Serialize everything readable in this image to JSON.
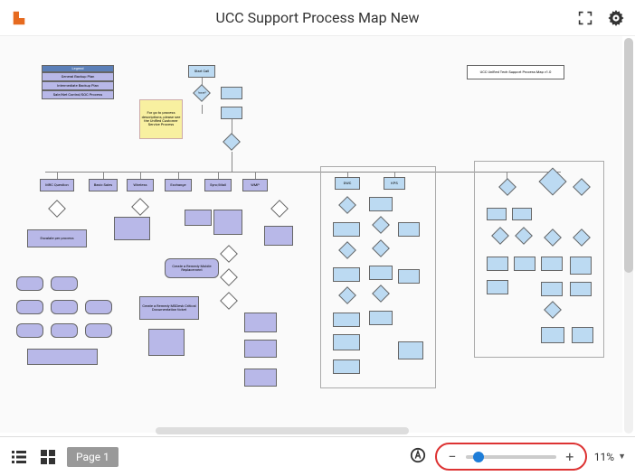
{
  "header": {
    "title": "UCC Support Process Map New"
  },
  "footer": {
    "page_tab": "Page 1",
    "zoom_value": "11%"
  },
  "icons": {
    "logo": "logo-l",
    "fullscreen": "fullscreen",
    "settings": "gear",
    "list": "list",
    "grid": "grid",
    "autozoom": "autozoom-circle-a",
    "minus": "−",
    "plus": "+",
    "caret": "▼"
  },
  "diagram": {
    "legend_title": "Legend",
    "legend_items": [
      "General Backup Plan",
      "Intermediate Backup Plan",
      "Sale/Net Control/SOC Process"
    ],
    "sticky_note": "For go to process descriptions, please see the Unified Customer Service Process",
    "header_right": "UCC Unified Tech Support Process Map v1.0",
    "start": "Start Call",
    "decision_main": "Issue?",
    "categories": [
      "MRC Question",
      "Basic Sales",
      "Wireless",
      "Exchange",
      "Sync/Mail",
      "WMP",
      "DWC",
      "KPS"
    ],
    "subprocess_samples": [
      "Create a Remedy Mobile Replacement",
      "Create a Remedy MSDesk Critical Documentation ticket",
      "Escalate per process"
    ]
  }
}
